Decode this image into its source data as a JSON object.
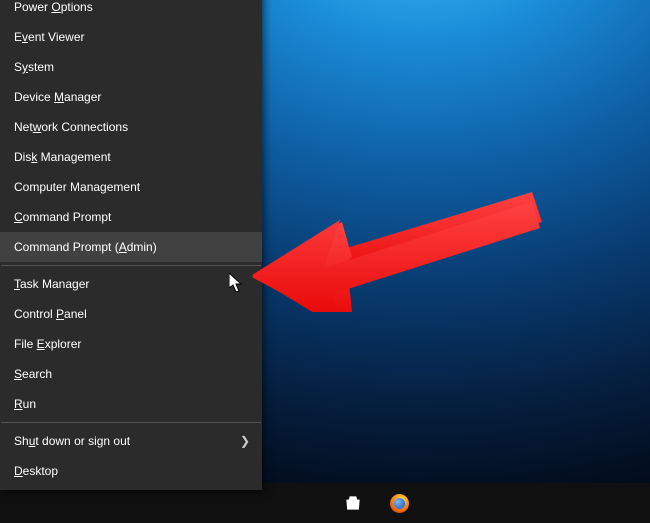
{
  "menu": {
    "items": [
      {
        "pre": "Power ",
        "u": "O",
        "post": "ptions",
        "submenu": false
      },
      {
        "pre": "E",
        "u": "v",
        "post": "ent Viewer",
        "submenu": false
      },
      {
        "pre": "S",
        "u": "y",
        "post": "stem",
        "submenu": false
      },
      {
        "pre": "Device ",
        "u": "M",
        "post": "anager",
        "submenu": false
      },
      {
        "pre": "Net",
        "u": "w",
        "post": "ork Connections",
        "submenu": false
      },
      {
        "pre": "Dis",
        "u": "k",
        "post": " Management",
        "submenu": false
      },
      {
        "pre": "Computer Mana",
        "u": "g",
        "post": "ement",
        "submenu": false
      },
      {
        "pre": "",
        "u": "C",
        "post": "ommand Prompt",
        "submenu": false
      },
      {
        "pre": "Command Prompt (",
        "u": "A",
        "post": "dmin)",
        "submenu": false,
        "hovered": true
      },
      {
        "sep": true
      },
      {
        "pre": "",
        "u": "T",
        "post": "ask Manager",
        "submenu": false
      },
      {
        "pre": "Control ",
        "u": "P",
        "post": "anel",
        "submenu": false
      },
      {
        "pre": "File ",
        "u": "E",
        "post": "xplorer",
        "submenu": false
      },
      {
        "pre": "",
        "u": "S",
        "post": "earch",
        "submenu": false
      },
      {
        "pre": "",
        "u": "R",
        "post": "un",
        "submenu": false
      },
      {
        "sep": true
      },
      {
        "pre": "Sh",
        "u": "u",
        "post": "t down or sign out",
        "submenu": true
      },
      {
        "pre": "",
        "u": "D",
        "post": "esktop",
        "submenu": false
      }
    ]
  },
  "taskbar": {
    "icons": [
      {
        "name": "store-icon"
      },
      {
        "name": "firefox-icon"
      }
    ]
  },
  "annotation_arrow_color": "#ff1a1a"
}
